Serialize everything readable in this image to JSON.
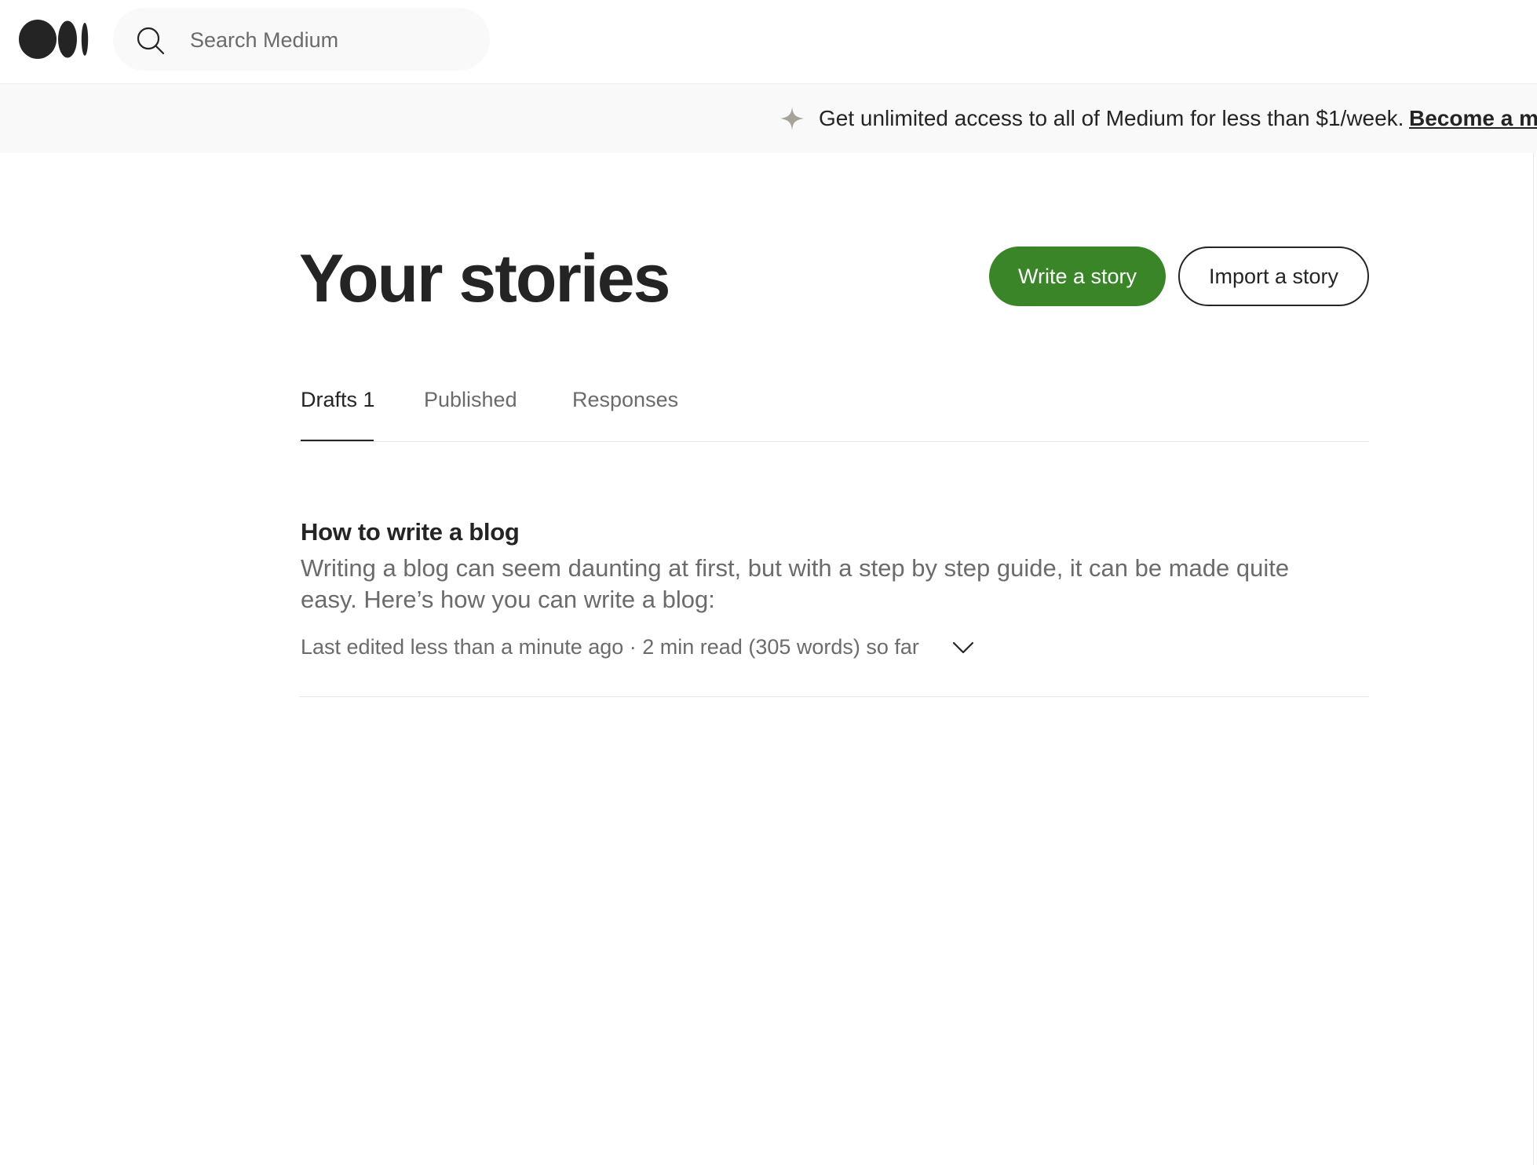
{
  "header": {
    "logo_icon": "medium-logo-icon",
    "search": {
      "placeholder": "Search Medium",
      "value": "",
      "icon": "search-icon"
    }
  },
  "banner": {
    "icon": "sparkle-icon",
    "text": "Get unlimited access to all of Medium for less than $1/week.",
    "link_label": "Become a me"
  },
  "page": {
    "title": "Your stories",
    "write_button": "Write a story",
    "import_button": "Import a story"
  },
  "tabs": [
    {
      "label": "Drafts 1",
      "active": true
    },
    {
      "label": "Published",
      "active": false
    },
    {
      "label": "Responses",
      "active": false
    }
  ],
  "stories": [
    {
      "title": "How to write a blog",
      "excerpt": "Writing a blog can seem daunting at first, but with a step by step guide, it can be made quite easy. Here’s how you can write a blog:",
      "meta": "Last edited less than a minute ago · 2 min read (305 words) so far",
      "menu_icon": "chevron-down-icon"
    }
  ],
  "colors": {
    "accent": "#3a8528",
    "text": "#242424",
    "muted": "#6b6b6b",
    "banner_bg": "#f9f9f9",
    "divider": "#e6e6e6"
  }
}
